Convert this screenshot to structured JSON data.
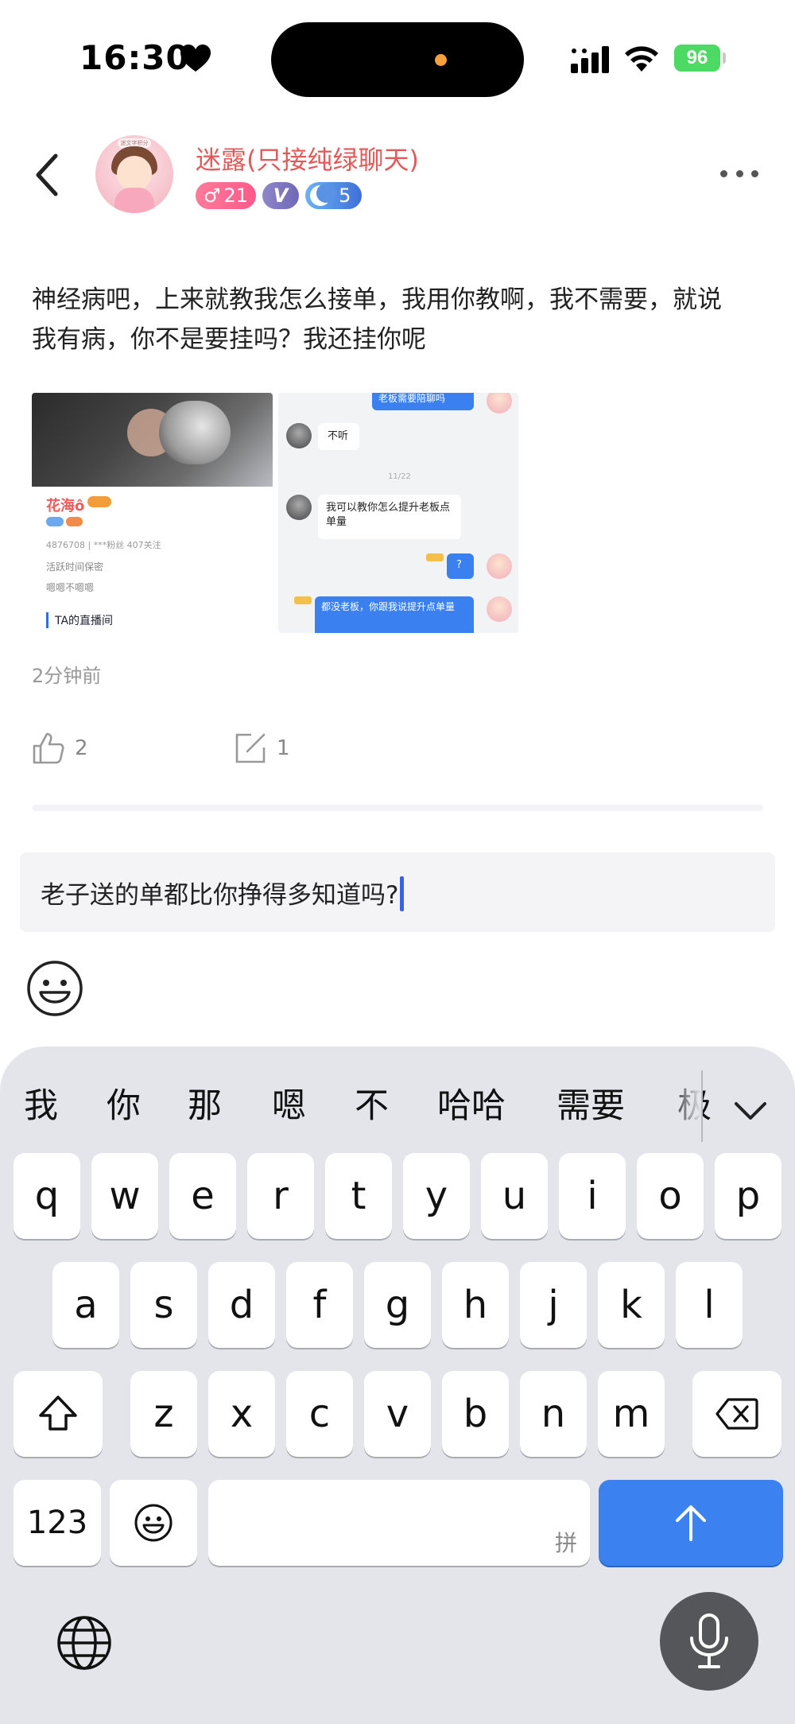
{
  "status_bar": {
    "time": "16:30",
    "battery": "96"
  },
  "header": {
    "username": "迷露(只接纯绿聊天)",
    "gender_symbol": "♂",
    "age": "21",
    "vip_badge": "V",
    "level": "5",
    "avatar_caption": "迷文字积分"
  },
  "post": {
    "text": "神经病吧，上来就教我怎么接单，我用你教啊，我不需要，就说我有病，你不是要挂吗？我还挂你呢",
    "time_ago": "2分钟前",
    "likes": "2",
    "comments": "1",
    "images": [
      {
        "name": "花海ô",
        "id_line": "4876708 | ***粉丝 407关注",
        "line1": "活跃时间保密",
        "line2": "嗯嗯不嗯嗯",
        "section": "TA的直播间"
      },
      {
        "msg1": "老板需要陪聊吗",
        "msg2": "不听",
        "date": "11/22",
        "msg3": "我可以教你怎么提升老板点单量",
        "msg4": "?",
        "msg5": "都没老板，你跟我说提升点单量"
      }
    ]
  },
  "reply": {
    "text": "老子送的单都比你挣得多知道吗?"
  },
  "keyboard": {
    "candidates": [
      "我",
      "你",
      "那",
      "嗯",
      "不",
      "哈哈",
      "需要",
      "极"
    ],
    "row1": [
      "q",
      "w",
      "e",
      "r",
      "t",
      "y",
      "u",
      "i",
      "o",
      "p"
    ],
    "row2": [
      "a",
      "s",
      "d",
      "f",
      "g",
      "h",
      "j",
      "k",
      "l"
    ],
    "row3": [
      "z",
      "x",
      "c",
      "v",
      "b",
      "n",
      "m"
    ],
    "numbers_label": "123",
    "space_hint": "拼"
  }
}
